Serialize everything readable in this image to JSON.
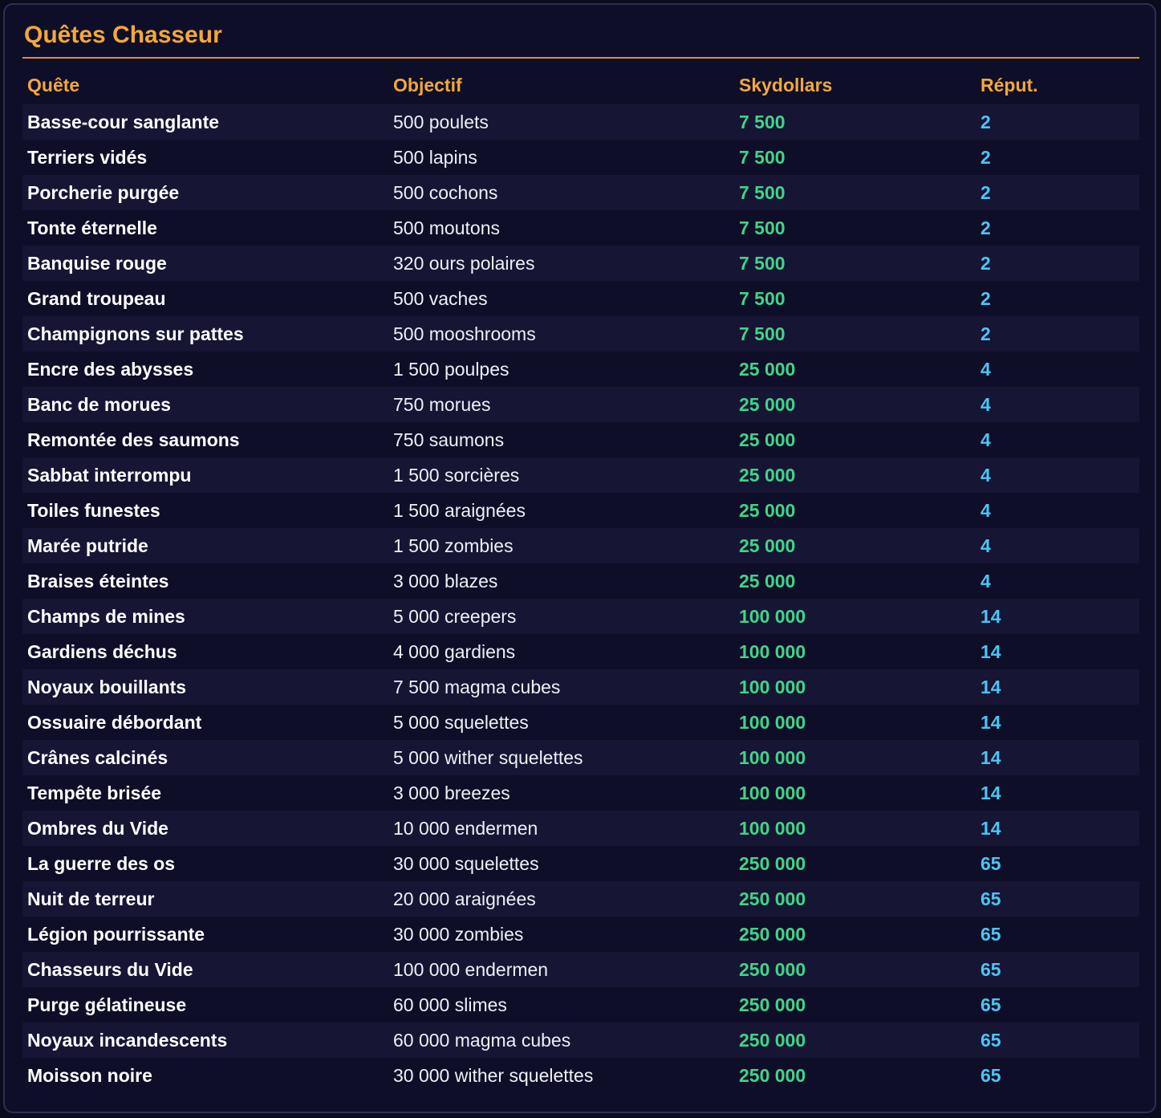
{
  "title": "Quêtes Chasseur",
  "columns": {
    "quest": "Quête",
    "objective": "Objectif",
    "skydollars": "Skydollars",
    "reputation": "Réput."
  },
  "colors": {
    "accent": "#f2a83a",
    "money": "#40d488",
    "reputation": "#4cc5f2",
    "background": "#0f0e28"
  },
  "quests": [
    {
      "name": "Basse-cour sanglante",
      "objective": "500 poulets",
      "skydollars": "7 500",
      "reputation": "2"
    },
    {
      "name": "Terriers vidés",
      "objective": "500 lapins",
      "skydollars": "7 500",
      "reputation": "2"
    },
    {
      "name": "Porcherie purgée",
      "objective": "500 cochons",
      "skydollars": "7 500",
      "reputation": "2"
    },
    {
      "name": "Tonte éternelle",
      "objective": "500 moutons",
      "skydollars": "7 500",
      "reputation": "2"
    },
    {
      "name": "Banquise rouge",
      "objective": "320 ours polaires",
      "skydollars": "7 500",
      "reputation": "2"
    },
    {
      "name": "Grand troupeau",
      "objective": "500 vaches",
      "skydollars": "7 500",
      "reputation": "2"
    },
    {
      "name": "Champignons sur pattes",
      "objective": "500 mooshrooms",
      "skydollars": "7 500",
      "reputation": "2"
    },
    {
      "name": "Encre des abysses",
      "objective": "1 500 poulpes",
      "skydollars": "25 000",
      "reputation": "4"
    },
    {
      "name": "Banc de morues",
      "objective": "750 morues",
      "skydollars": "25 000",
      "reputation": "4"
    },
    {
      "name": "Remontée des saumons",
      "objective": "750 saumons",
      "skydollars": "25 000",
      "reputation": "4"
    },
    {
      "name": "Sabbat interrompu",
      "objective": "1 500 sorcières",
      "skydollars": "25 000",
      "reputation": "4"
    },
    {
      "name": "Toiles funestes",
      "objective": "1 500 araignées",
      "skydollars": "25 000",
      "reputation": "4"
    },
    {
      "name": "Marée putride",
      "objective": "1 500 zombies",
      "skydollars": "25 000",
      "reputation": "4"
    },
    {
      "name": "Braises éteintes",
      "objective": "3 000 blazes",
      "skydollars": "25 000",
      "reputation": "4"
    },
    {
      "name": "Champs de mines",
      "objective": "5 000 creepers",
      "skydollars": "100 000",
      "reputation": "14"
    },
    {
      "name": "Gardiens déchus",
      "objective": "4 000 gardiens",
      "skydollars": "100 000",
      "reputation": "14"
    },
    {
      "name": "Noyaux bouillants",
      "objective": "7 500 magma cubes",
      "skydollars": "100 000",
      "reputation": "14"
    },
    {
      "name": "Ossuaire débordant",
      "objective": "5 000 squelettes",
      "skydollars": "100 000",
      "reputation": "14"
    },
    {
      "name": "Crânes calcinés",
      "objective": "5 000 wither squelettes",
      "skydollars": "100 000",
      "reputation": "14"
    },
    {
      "name": "Tempête brisée",
      "objective": "3 000 breezes",
      "skydollars": "100 000",
      "reputation": "14"
    },
    {
      "name": "Ombres du Vide",
      "objective": "10 000 endermen",
      "skydollars": "100 000",
      "reputation": "14"
    },
    {
      "name": "La guerre des os",
      "objective": "30 000 squelettes",
      "skydollars": "250 000",
      "reputation": "65"
    },
    {
      "name": "Nuit de terreur",
      "objective": "20 000 araignées",
      "skydollars": "250 000",
      "reputation": "65"
    },
    {
      "name": "Légion pourrissante",
      "objective": "30 000 zombies",
      "skydollars": "250 000",
      "reputation": "65"
    },
    {
      "name": "Chasseurs du Vide",
      "objective": "100 000 endermen",
      "skydollars": "250 000",
      "reputation": "65"
    },
    {
      "name": "Purge gélatineuse",
      "objective": "60 000 slimes",
      "skydollars": "250 000",
      "reputation": "65"
    },
    {
      "name": "Noyaux incandescents",
      "objective": "60 000 magma cubes",
      "skydollars": "250 000",
      "reputation": "65"
    },
    {
      "name": "Moisson noire",
      "objective": "30 000 wither squelettes",
      "skydollars": "250 000",
      "reputation": "65"
    }
  ]
}
